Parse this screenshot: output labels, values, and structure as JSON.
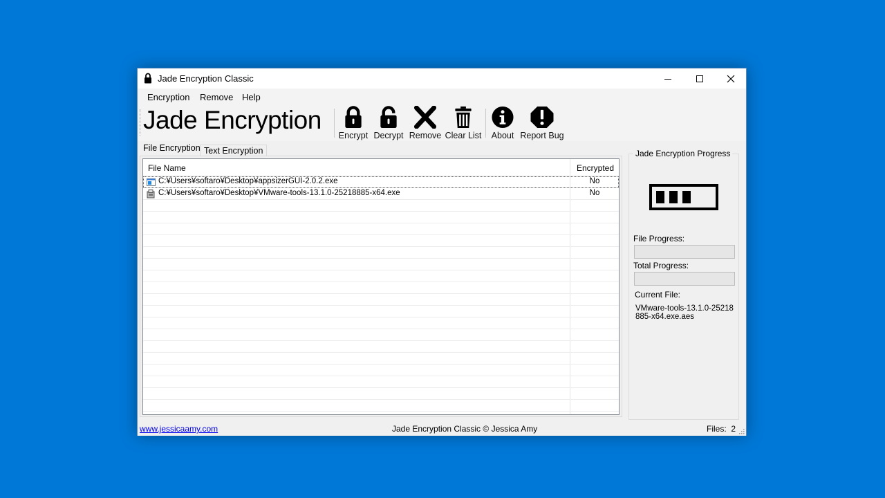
{
  "window": {
    "title": "Jade Encryption Classic"
  },
  "menu": [
    "Encryption",
    "Remove",
    "Help"
  ],
  "toolbar": {
    "brand": "Jade Encryption",
    "buttons": [
      {
        "label": "Encrypt",
        "icon": "lock-icon"
      },
      {
        "label": "Decrypt",
        "icon": "unlock-icon"
      },
      {
        "label": "Remove",
        "icon": "x-icon"
      },
      {
        "label": "Clear List",
        "icon": "trash-icon"
      },
      {
        "label": "About",
        "icon": "info-icon"
      },
      {
        "label": "Report Bug",
        "icon": "alert-icon"
      }
    ]
  },
  "tabs": [
    "File Encryption",
    "Text Encryption"
  ],
  "list": {
    "columns": [
      "File Name",
      "Encrypted"
    ],
    "rows": [
      {
        "name": "C:¥Users¥softaro¥Desktop¥appsizerGUI-2.0.2.exe",
        "encrypted": "No",
        "icon": "exe-window-icon"
      },
      {
        "name": "C:¥Users¥softaro¥Desktop¥VMware-tools-13.1.0-25218885-x64.exe",
        "encrypted": "No",
        "icon": "installer-icon"
      }
    ]
  },
  "progress": {
    "group_title": "Jade Encryption Progress",
    "battery_icon": "battery-icon",
    "file_label": "File Progress:",
    "file_value": 0,
    "total_label": "Total Progress:",
    "total_value": 0,
    "current_label": "Current File:",
    "current_file": "VMware-tools-13.1.0-25218885-x64.exe.aes"
  },
  "status": {
    "link": "www.jessicaamy.com",
    "center": "Jade Encryption Classic © Jessica Amy",
    "files_label": "Files:",
    "files_count": "2"
  }
}
